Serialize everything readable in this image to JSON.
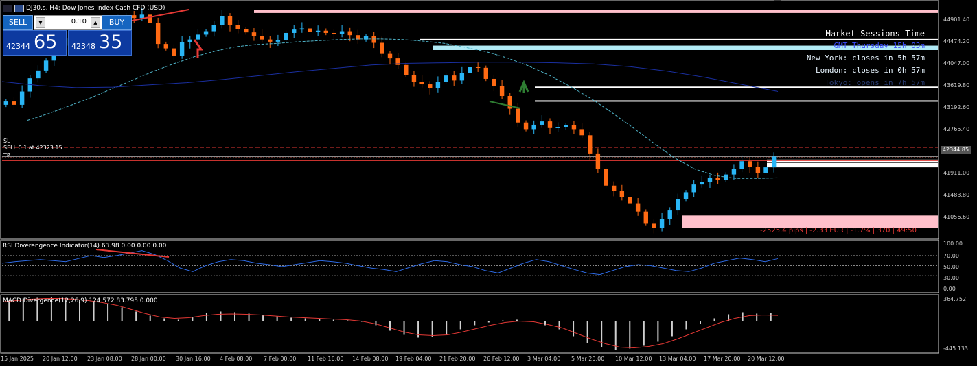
{
  "header": {
    "symbol_title": "DJ30.s, H4:  Dow Jones Index Cash CFD (USD)"
  },
  "trade_panel": {
    "sell_label": "SELL",
    "buy_label": "BUY",
    "lot": "0.10",
    "sell_small": "42344",
    "sell_big": "65",
    "buy_small": "42348",
    "buy_big": "35",
    "colors": {
      "panel": "#0d3aa0",
      "button": "#1565c0"
    }
  },
  "sessions": {
    "title": "Market Sessions Time",
    "gmt": "GMT Thursday 15h 03m",
    "new_york": "New York: closes in 5h 57m",
    "london": "London: closes in 0h 57m",
    "tokyo": "Tokyo: opens in 7h 57m"
  },
  "orders": {
    "sl": "SL",
    "sell": "SELL 0.1 at 42323.15",
    "tp": "TP"
  },
  "pnl": "-2525.4 pips | -2.33 EUR | -1.7% | 370 | 49:50",
  "current_price": "42344.85",
  "indicators": {
    "rsi_title": "RSI Diverengence Indicator(14) 63.98 0.00 0.00 0.00",
    "macd_title": "MACD Divergence(12,26,9) 124.572 83.795 0.000"
  },
  "axes": {
    "price_ticks": [
      "44901.40",
      "44474.20",
      "44047.00",
      "43619.80",
      "43192.60",
      "42765.40",
      "41911.00",
      "41483.80",
      "41056.60"
    ],
    "rsi_ticks": [
      "100.00",
      "70.00",
      "50.00",
      "30.00",
      "0.00"
    ],
    "macd_ticks": [
      "364.752",
      "-445.133"
    ],
    "time_ticks": [
      "15 Jan 2025",
      "20 Jan 12:00",
      "23 Jan 08:00",
      "28 Jan 00:00",
      "30 Jan 16:00",
      "4 Feb 08:00",
      "7 Feb 00:00",
      "11 Feb 16:00",
      "14 Feb 08:00",
      "19 Feb 04:00",
      "21 Feb 20:00",
      "26 Feb 12:00",
      "3 Mar 04:00",
      "5 Mar 20:00",
      "10 Mar 12:00",
      "13 Mar 04:00",
      "17 Mar 20:00",
      "20 Mar 12:00"
    ]
  },
  "chart_data": {
    "type": "candlestick",
    "symbol": "DJ30.s",
    "timeframe": "H4",
    "ylim": [
      40900,
      45100
    ],
    "close": [
      43340,
      43280,
      43520,
      43760,
      43900,
      44080,
      44230,
      44350,
      44480,
      44520,
      44590,
      44470,
      44680,
      44760,
      44810,
      44900,
      44850,
      44910,
      44760,
      44380,
      44300,
      44170,
      44410,
      44460,
      44550,
      44610,
      44720,
      44880,
      44720,
      44650,
      44590,
      44530,
      44460,
      44420,
      44450,
      44580,
      44640,
      44660,
      44600,
      44620,
      44580,
      44560,
      44610,
      44540,
      44460,
      44520,
      44400,
      44200,
      44120,
      44000,
      43820,
      43700,
      43650,
      43580,
      43700,
      43810,
      43720,
      43850,
      43960,
      43950,
      43750,
      43620,
      43440,
      43210,
      42960,
      42840,
      42920,
      42980,
      42860,
      42870,
      42910,
      42840,
      42730,
      42400,
      42120,
      41820,
      41720,
      41610,
      41500,
      41350,
      41130,
      41050,
      41210,
      41370,
      41580,
      41700,
      41840,
      41880,
      41960,
      41920,
      42020,
      42120,
      42260,
      42160,
      42040,
      42150,
      42344.85
    ],
    "ma_fast": [
      43000,
      43120,
      43260,
      43400,
      43560,
      43720,
      43880,
      44020,
      44150,
      44250,
      44330,
      44370,
      44390,
      44420,
      44440,
      44460,
      44470,
      44470,
      44460,
      44430,
      44390,
      44320,
      44240,
      44130,
      43990,
      43820,
      43620,
      43400,
      43150,
      42880,
      42600,
      42330,
      42120,
      42000,
      41950,
      41950,
      41960
    ],
    "ma_slow": [
      43700,
      43630,
      43590,
      43600,
      43640,
      43680,
      43740,
      43810,
      43880,
      43940,
      44000,
      44030,
      44040,
      44050,
      44050,
      44040,
      44020,
      43970,
      43890,
      43780,
      43650,
      43520
    ],
    "levels": {
      "sl": 42510,
      "sell_entry": 42323.15,
      "tp": 42270,
      "current": 42344.85
    },
    "zones": [
      {
        "top": 45000,
        "bottom": 44940,
        "color": "#ffc0cb"
      },
      {
        "top": 44470,
        "bottom": 44450,
        "color": "#ffffff"
      },
      {
        "top": 44350,
        "bottom": 44270,
        "color": "#b0eaf5"
      },
      {
        "top": 43610,
        "bottom": 43590,
        "color": "#ffffff"
      },
      {
        "top": 43360,
        "bottom": 43340,
        "color": "#ffffff"
      },
      {
        "top": 41280,
        "bottom": 41060,
        "color": "#ffc0cb"
      },
      {
        "top": 42290,
        "bottom": 42250,
        "color": "#ffffff"
      },
      {
        "top": 42230,
        "bottom": 42150,
        "color": "#ffffff"
      }
    ],
    "rsi": {
      "ylim": [
        0,
        100
      ],
      "values": [
        55,
        58,
        60,
        62,
        60,
        58,
        64,
        70,
        66,
        70,
        75,
        80,
        72,
        60,
        45,
        38,
        50,
        58,
        62,
        60,
        55,
        52,
        48,
        52,
        56,
        60,
        58,
        55,
        50,
        45,
        42,
        38,
        46,
        54,
        60,
        58,
        52,
        48,
        40,
        35,
        45,
        55,
        62,
        58,
        50,
        42,
        35,
        32,
        40,
        48,
        52,
        50,
        45,
        40,
        38,
        45,
        55,
        60,
        65,
        62,
        58,
        63.98
      ]
    },
    "macd": {
      "ylim": [
        -445.133,
        364.752
      ],
      "histogram": [
        300,
        330,
        340,
        350,
        330,
        310,
        290,
        260,
        200,
        140,
        80,
        40,
        20,
        60,
        120,
        140,
        130,
        110,
        90,
        70,
        50,
        40,
        30,
        20,
        10,
        -10,
        -60,
        -140,
        -200,
        -240,
        -230,
        -200,
        -120,
        -60,
        -20,
        10,
        20,
        0,
        -60,
        -120,
        -220,
        -320,
        -380,
        -420,
        -400,
        -360,
        -300,
        -220,
        -120,
        -40,
        40,
        100,
        130,
        110,
        124.572
      ],
      "signal": [
        280,
        300,
        320,
        330,
        330,
        320,
        300,
        270,
        230,
        170,
        110,
        60,
        40,
        50,
        80,
        100,
        105,
        100,
        90,
        75,
        60,
        50,
        40,
        30,
        20,
        0,
        -40,
        -100,
        -160,
        -200,
        -210,
        -200,
        -160,
        -110,
        -60,
        -20,
        0,
        -10,
        -50,
        -100,
        -180,
        -260,
        -330,
        -380,
        -390,
        -370,
        -330,
        -260,
        -180,
        -100,
        -20,
        40,
        80,
        90,
        83.795
      ]
    }
  }
}
